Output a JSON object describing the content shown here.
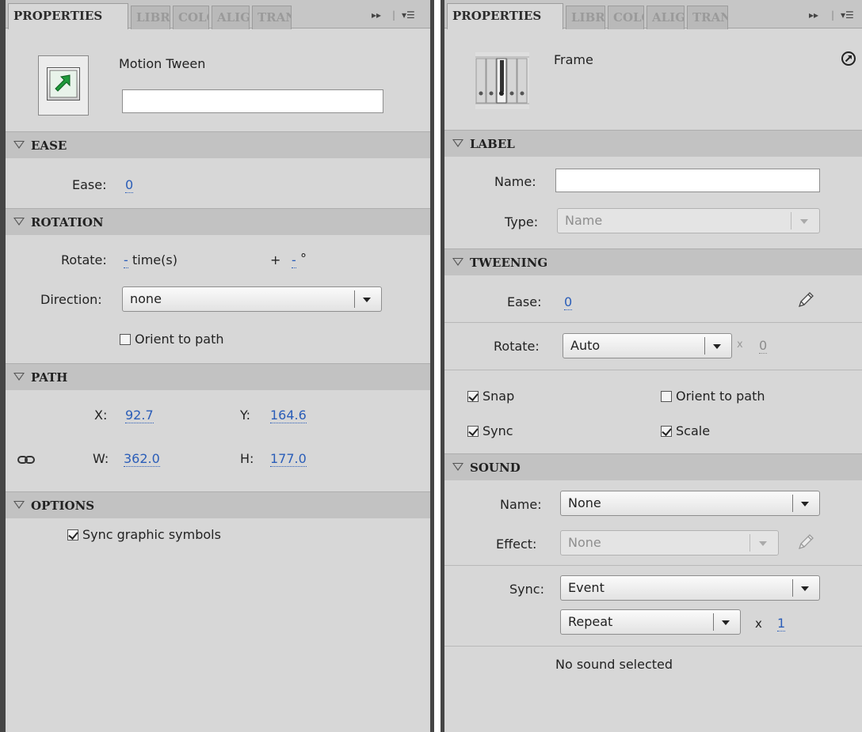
{
  "left": {
    "tabs": [
      "PROPERTIES",
      "LIBRARY",
      "COLOR",
      "ALIGN",
      "TRANSFORM"
    ],
    "tab_visible": [
      "PROPERTIES",
      "LIBR/",
      "COLO",
      "ALIG!",
      "TRAN!"
    ],
    "header": {
      "title": "Motion Tween",
      "name_value": "",
      "icon": "motion-tween-icon"
    },
    "ease": {
      "section": "EASE",
      "label": "Ease:",
      "value": "0"
    },
    "rotation": {
      "section": "ROTATION",
      "rotate_label": "Rotate:",
      "rotate_times": "-",
      "times_text": "time(s)",
      "plus": "+",
      "degrees": "-",
      "degree_symbol": "°",
      "direction_label": "Direction:",
      "direction_value": "none",
      "orient_label": "Orient to path",
      "orient_checked": false
    },
    "path": {
      "section": "PATH",
      "x_label": "X:",
      "x_value": "92.7",
      "y_label": "Y:",
      "y_value": "164.6",
      "w_label": "W:",
      "w_value": "362.0",
      "h_label": "H:",
      "h_value": "177.0"
    },
    "options": {
      "section": "OPTIONS",
      "sync_label": "Sync graphic symbols",
      "sync_checked": true
    }
  },
  "right": {
    "tabs": [
      "PROPERTIES",
      "LIBRARY",
      "COLOR",
      "ALIGN",
      "TRANSFORM"
    ],
    "tab_visible": [
      "PROPERTIES",
      "LIBR/",
      "COLO",
      "ALIG!",
      "TRAN!"
    ],
    "header": {
      "title": "Frame",
      "icon": "frame-icon"
    },
    "label": {
      "section": "LABEL",
      "name_label": "Name:",
      "name_value": "",
      "type_label": "Type:",
      "type_value": "Name"
    },
    "tweening": {
      "section": "TWEENING",
      "ease_label": "Ease:",
      "ease_value": "0",
      "rotate_label": "Rotate:",
      "rotate_value": "Auto",
      "times_x": "x",
      "times_value": "0",
      "snap_label": "Snap",
      "snap_checked": true,
      "orient_label": "Orient to path",
      "orient_checked": false,
      "sync_label": "Sync",
      "sync_checked": true,
      "scale_label": "Scale",
      "scale_checked": true
    },
    "sound": {
      "section": "SOUND",
      "name_label": "Name:",
      "name_value": "None",
      "effect_label": "Effect:",
      "effect_value": "None",
      "sync_label": "Sync:",
      "sync_value": "Event",
      "repeat_value": "Repeat",
      "repeat_x": "x",
      "repeat_count": "1",
      "status": "No sound selected"
    }
  },
  "colors": {
    "panel_bg": "#d7d7d7",
    "section_bg": "#c2c2c2",
    "link_blue": "#2a5db8",
    "arrow_green": "#1e9a3a"
  }
}
